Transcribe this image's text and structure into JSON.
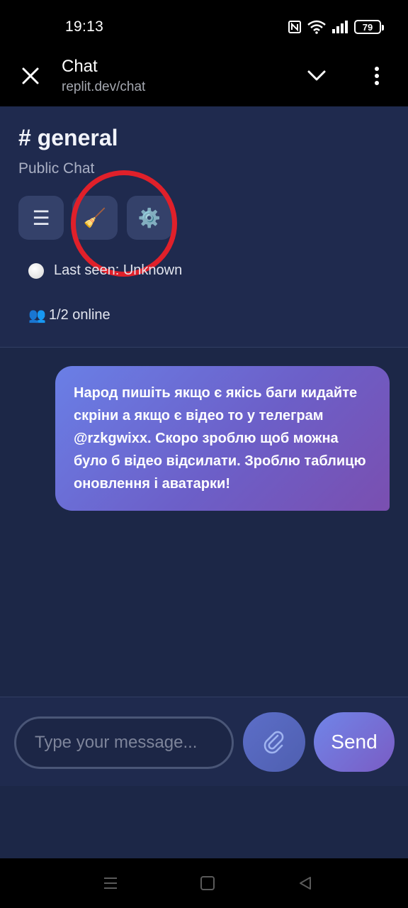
{
  "status_bar": {
    "time": "19:13",
    "battery": "79",
    "icons": [
      "nfc-icon",
      "wifi-icon",
      "signal-icon",
      "battery-icon"
    ]
  },
  "browser": {
    "title": "Chat",
    "url": "replit.dev/chat",
    "icons": [
      "close-icon",
      "chevron-down-icon",
      "more-vert-icon"
    ]
  },
  "channel": {
    "title": "# general",
    "subtitle": "Public Chat",
    "tools": [
      {
        "name": "menu",
        "glyph": "☰"
      },
      {
        "name": "clear",
        "glyph": "🧹"
      },
      {
        "name": "settings",
        "glyph": "⚙️"
      }
    ],
    "last_seen": "Last seen: Unknown",
    "online": "1/2 online",
    "online_glyph": "👥",
    "highlight_color": "#e0202a"
  },
  "messages": [
    {
      "text": "Народ пишіть якщо є якісь баги кидайте скріни а якщо є відео то у телеграм @rzkgwixx. Скоро зроблю щоб можна було б відео відсилати. Зроблю таблицю оновлення і аватарки!",
      "outgoing": true
    }
  ],
  "composer": {
    "placeholder": "Type your message...",
    "attach_glyph": "📎",
    "send_label": "Send"
  },
  "nav": {
    "icons": [
      "recent-apps-icon",
      "home-icon",
      "back-icon"
    ]
  },
  "colors": {
    "app_bg": "#1c2747",
    "header_bg": "#1f2a4e",
    "bubble_start": "#6a7fe6",
    "bubble_end": "#7a4fb0"
  }
}
